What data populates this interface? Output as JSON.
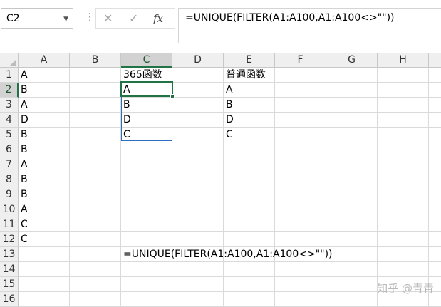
{
  "name_box": {
    "value": "C2"
  },
  "formula_bar": {
    "cancel_icon": "✕",
    "enter_icon": "✓",
    "fx_label": "fx",
    "formula": "=UNIQUE(FILTER(A1:A100,A1:A100<>\"\"))"
  },
  "columns": [
    "A",
    "B",
    "C",
    "D",
    "E",
    "F",
    "G",
    "H"
  ],
  "rows": [
    "1",
    "2",
    "3",
    "4",
    "5",
    "6",
    "7",
    "8",
    "9",
    "10",
    "11",
    "12",
    "13",
    "14",
    "15",
    "16"
  ],
  "cells": {
    "A": [
      "A",
      "B",
      "A",
      "D",
      "B",
      "B",
      "A",
      "B",
      "B",
      "A",
      "C",
      "C"
    ],
    "C": [
      "365函数",
      "A",
      "B",
      "D",
      "C"
    ],
    "E": [
      "普通函数",
      "A",
      "B",
      "D",
      "C"
    ],
    "C13": "=UNIQUE(FILTER(A1:A100,A1:A100<>\"\"))"
  },
  "watermark": "知乎 @青青",
  "colors": {
    "selection": "#217346",
    "spill_border": "#2e6ebf"
  }
}
